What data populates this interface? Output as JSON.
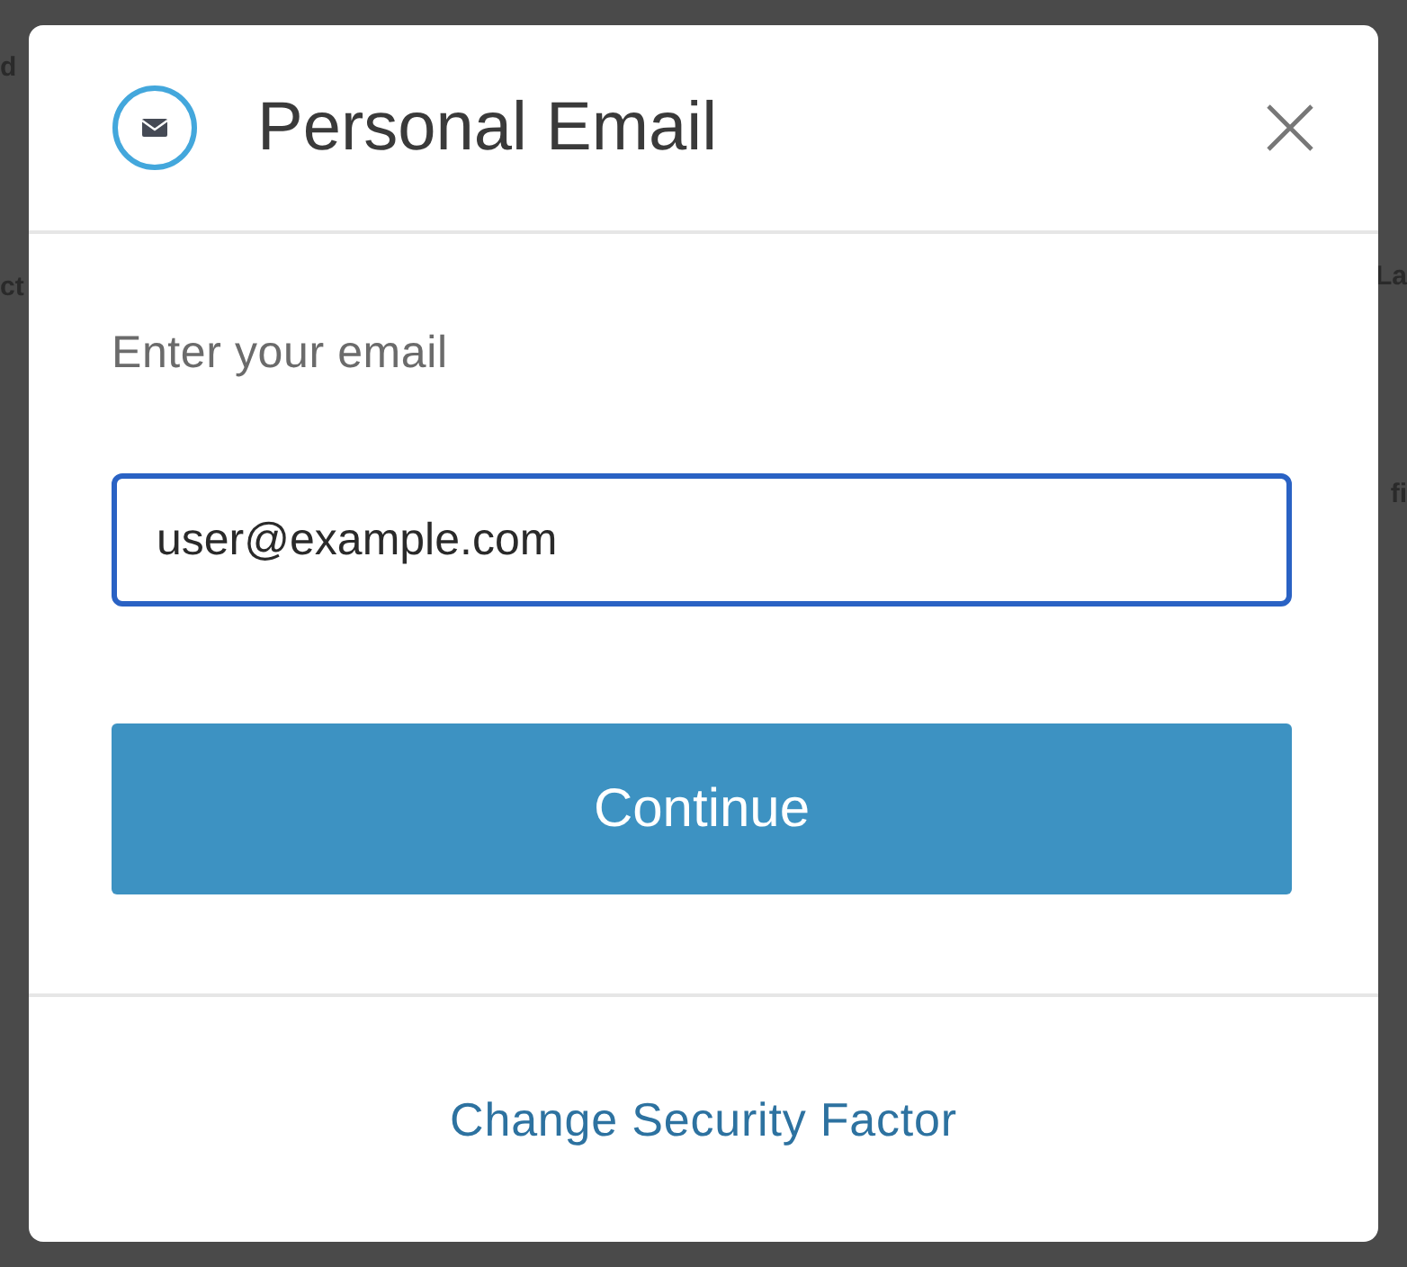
{
  "background": {
    "left_fragments": [
      "d",
      "ct"
    ],
    "right_fragments": [
      "La",
      "fi"
    ]
  },
  "dialog": {
    "title": "Personal Email",
    "label": "Enter your email",
    "email_field": {
      "value": "user@example.com",
      "focused": true
    },
    "primary_button": "Continue",
    "footer_link": "Change Security Factor"
  }
}
